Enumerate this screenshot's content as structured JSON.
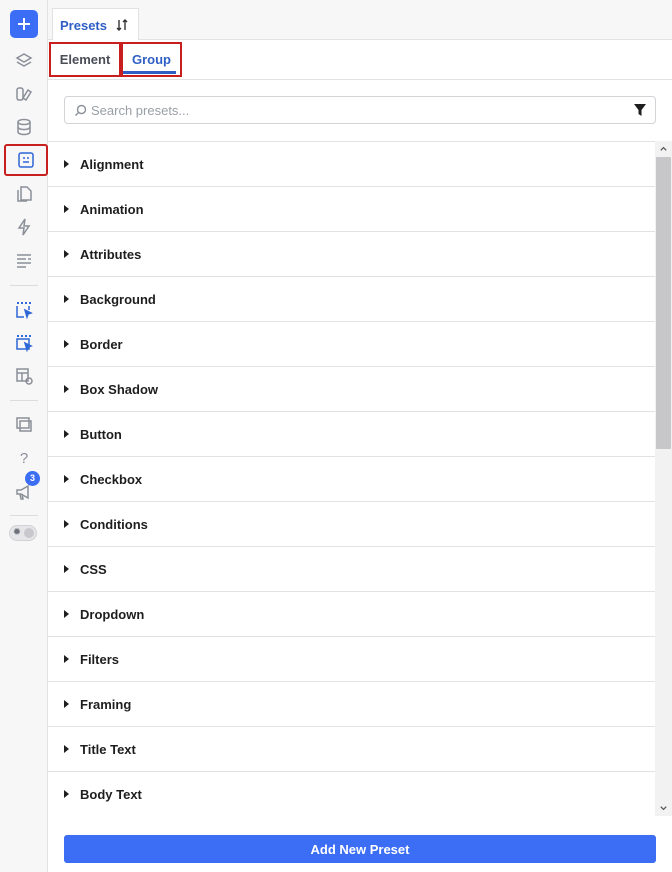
{
  "header": {
    "tab_label": "Presets"
  },
  "subtabs": {
    "element": "Element",
    "group": "Group"
  },
  "search": {
    "placeholder": "Search presets..."
  },
  "list": {
    "items": [
      "Alignment",
      "Animation",
      "Attributes",
      "Background",
      "Border",
      "Box Shadow",
      "Button",
      "Checkbox",
      "Conditions",
      "CSS",
      "Dropdown",
      "Filters",
      "Framing",
      "Title Text",
      "Body Text"
    ]
  },
  "rail": {
    "notification_count": "3",
    "help_label": "?"
  },
  "footer": {
    "add_label": "Add New Preset"
  },
  "colors": {
    "accent": "#3b6ef5",
    "tab_text": "#2f5fc5",
    "highlight": "#c81e1e"
  }
}
